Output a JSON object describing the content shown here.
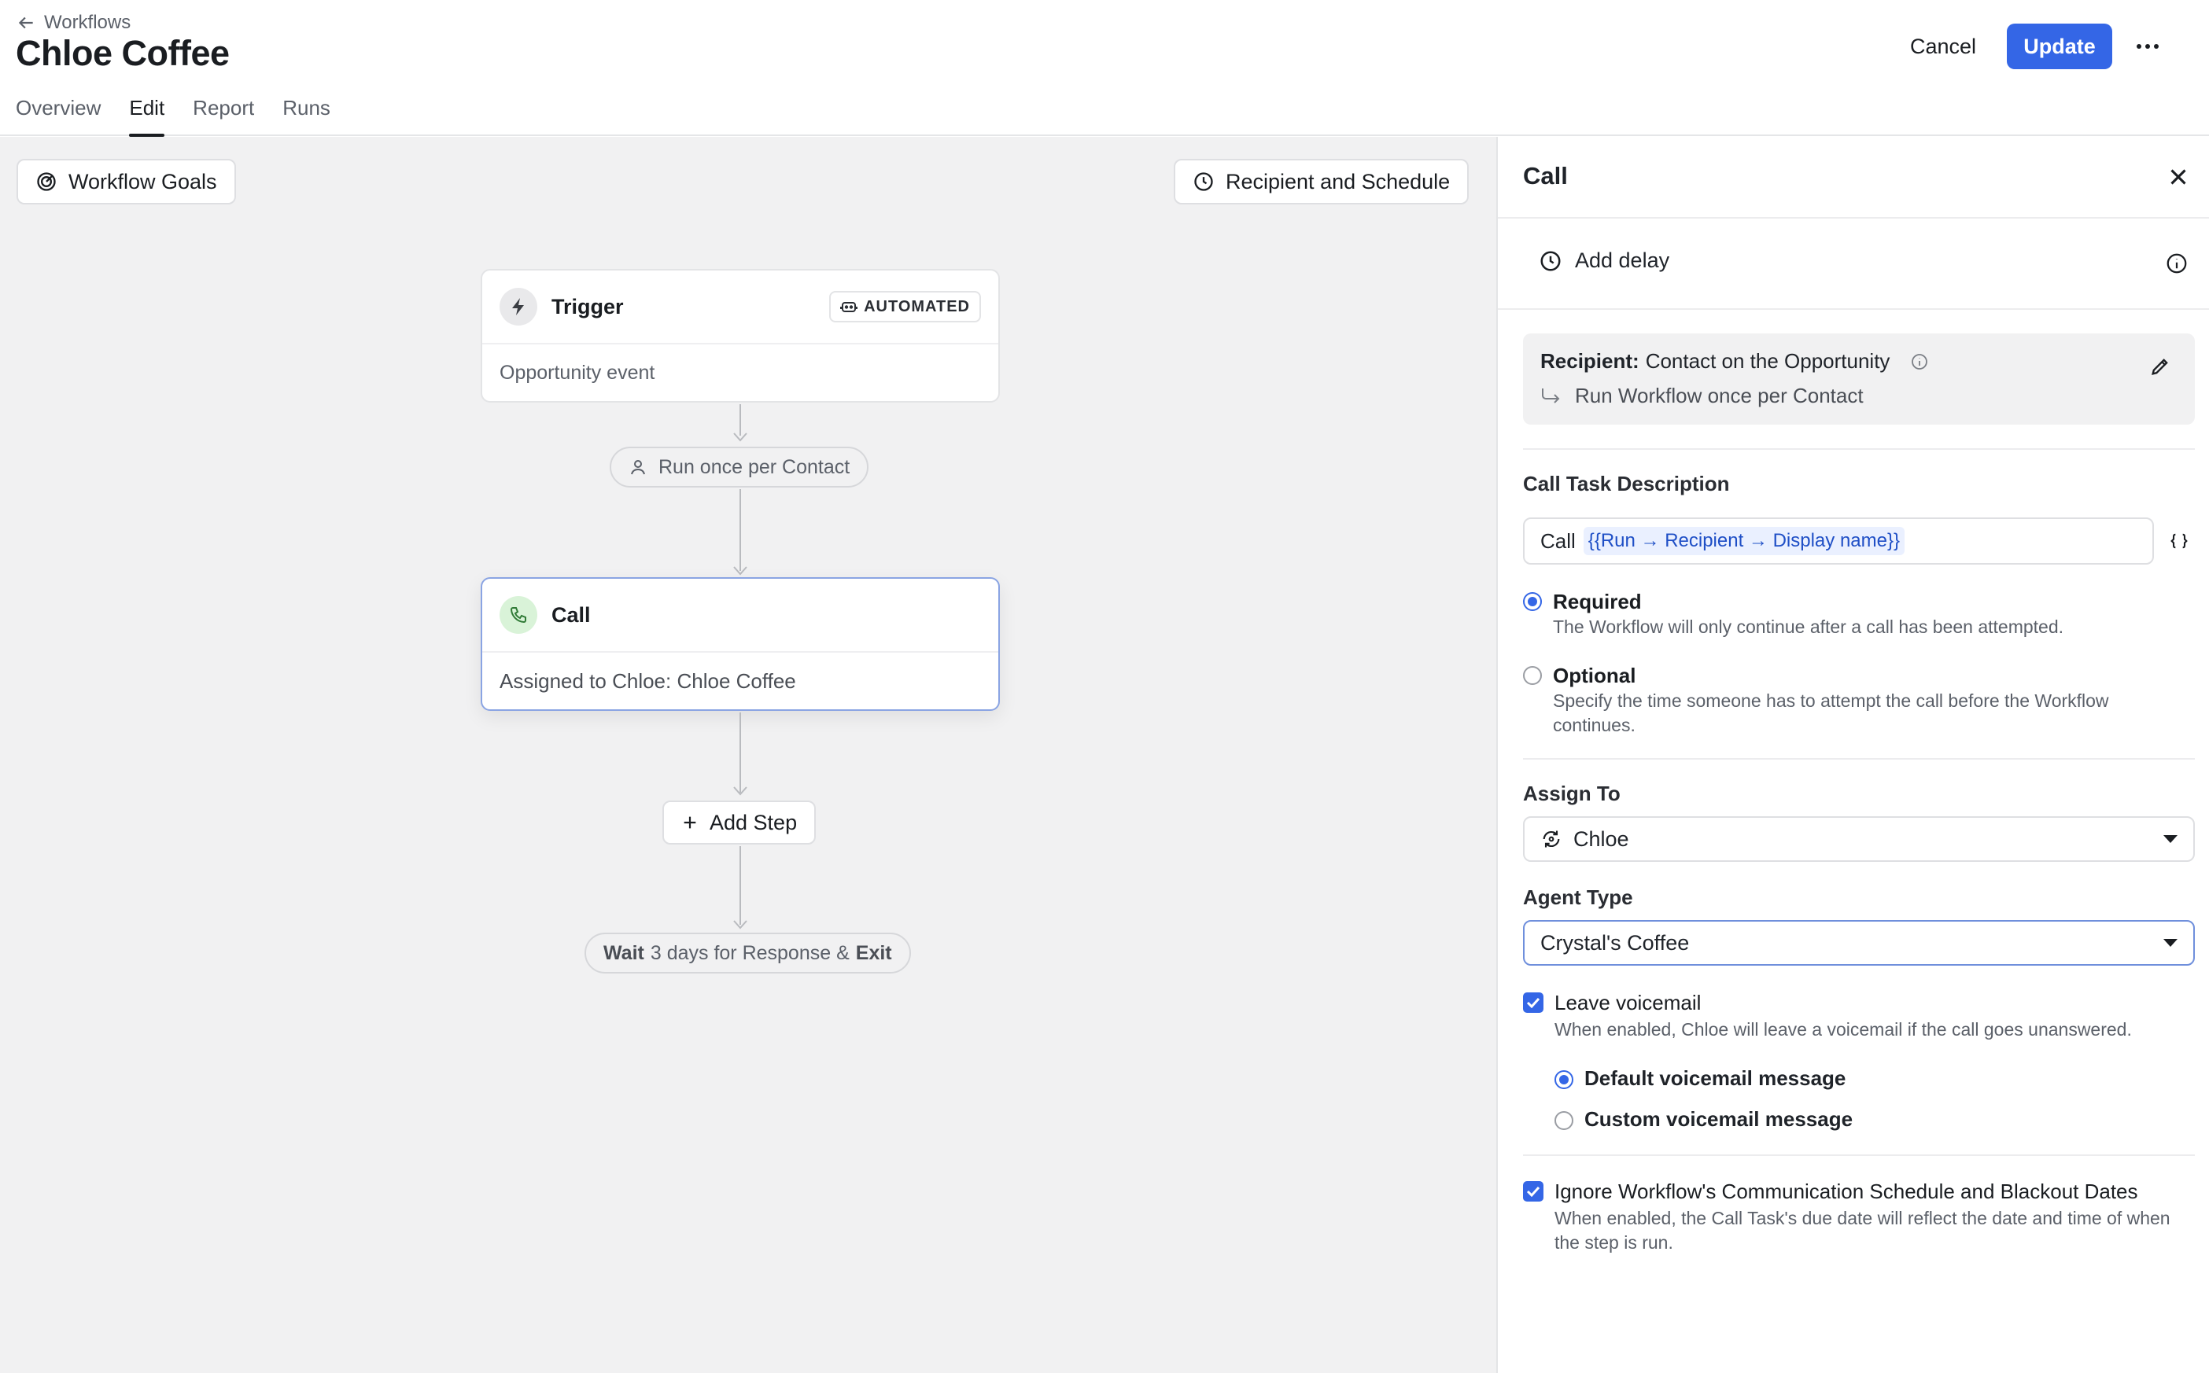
{
  "header": {
    "back_label": "Workflows",
    "title": "Chloe Coffee",
    "tabs": [
      {
        "label": "Overview",
        "active": false
      },
      {
        "label": "Edit",
        "active": true
      },
      {
        "label": "Report",
        "active": false
      },
      {
        "label": "Runs",
        "active": false
      }
    ],
    "cancel_label": "Cancel",
    "update_label": "Update",
    "accent_color": "#3466e6"
  },
  "canvas": {
    "workflow_goals_label": "Workflow Goals",
    "recipient_schedule_label": "Recipient and Schedule",
    "trigger": {
      "title": "Trigger",
      "badge": "AUTOMATED",
      "body": "Opportunity event"
    },
    "run_once_chip": "Run once per Contact",
    "call_node": {
      "title": "Call",
      "body": "Assigned to Chloe: Chloe Coffee"
    },
    "add_step_label": "Add Step",
    "exit_chip": {
      "wait": "Wait",
      "middle": "3 days for Response &",
      "exit": "Exit"
    }
  },
  "panel": {
    "title": "Call",
    "add_delay_label": "Add delay",
    "recipient": {
      "label": "Recipient:",
      "value": "Contact on the Opportunity",
      "run_mode": "Run Workflow once per Contact"
    },
    "call_task": {
      "label": "Call Task Description",
      "prefix": "Call",
      "token": "{{Run → Recipient → Display name}}"
    },
    "completion": {
      "required_title": "Required",
      "required_desc": "The Workflow will only continue after a call has been attempted.",
      "optional_title": "Optional",
      "optional_desc": "Specify the time someone has to attempt the call before the Workflow continues.",
      "selected": "Required"
    },
    "assign_to": {
      "label": "Assign To",
      "value": "Chloe"
    },
    "agent_type": {
      "label": "Agent Type",
      "value": "Crystal's Coffee"
    },
    "voicemail": {
      "title": "Leave voicemail",
      "desc": "When enabled, Chloe will leave a voicemail if the call goes unanswered.",
      "checked": true,
      "default_label": "Default voicemail message",
      "custom_label": "Custom voicemail message",
      "selected": "Default voicemail message"
    },
    "ignore_schedule": {
      "title": "Ignore Workflow's Communication Schedule and Blackout Dates",
      "desc": "When enabled, the Call Task's due date will reflect the date and time of when the step is run.",
      "checked": true
    }
  }
}
